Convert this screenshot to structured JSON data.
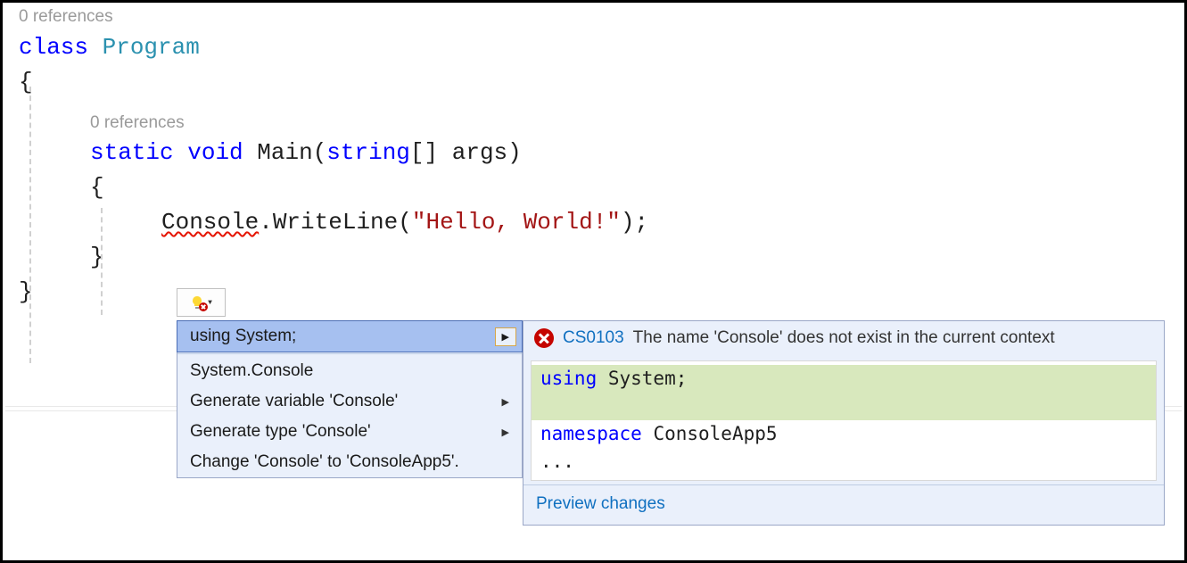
{
  "codelens": {
    "class_refs": "0 references",
    "method_refs": "0 references"
  },
  "code": {
    "class_kw": "class",
    "class_name": "Program",
    "open_brace": "{",
    "static_kw": "static",
    "void_kw": "void",
    "main_name": "Main",
    "open_paren": "(",
    "string_kw": "string",
    "brackets": "[]",
    "args": "args",
    "close_paren": ")",
    "method_open": "{",
    "console": "Console",
    "dot": ".",
    "writeline": "WriteLine",
    "call_open": "(",
    "string_literal": "\"Hello, World!\"",
    "call_close": ")",
    "semi": ";",
    "method_close": "}",
    "class_close": "}"
  },
  "quickfix": {
    "items": [
      {
        "label": "using System;",
        "selected": true,
        "submenu": true
      },
      {
        "label": "System.Console",
        "selected": false,
        "submenu": false
      },
      {
        "label": "Generate variable 'Console'",
        "selected": false,
        "submenu": true
      },
      {
        "label": "Generate type 'Console'",
        "selected": false,
        "submenu": true
      },
      {
        "label": "Change 'Console' to 'ConsoleApp5'.",
        "selected": false,
        "submenu": false
      }
    ]
  },
  "error": {
    "code": "CS0103",
    "message": "The name 'Console' does not exist in the current context"
  },
  "preview": {
    "using_kw": "using",
    "using_ns": " System;",
    "ns_kw": "namespace",
    "ns_name": " ConsoleApp5",
    "ellipsis": "...",
    "link": "Preview changes"
  }
}
